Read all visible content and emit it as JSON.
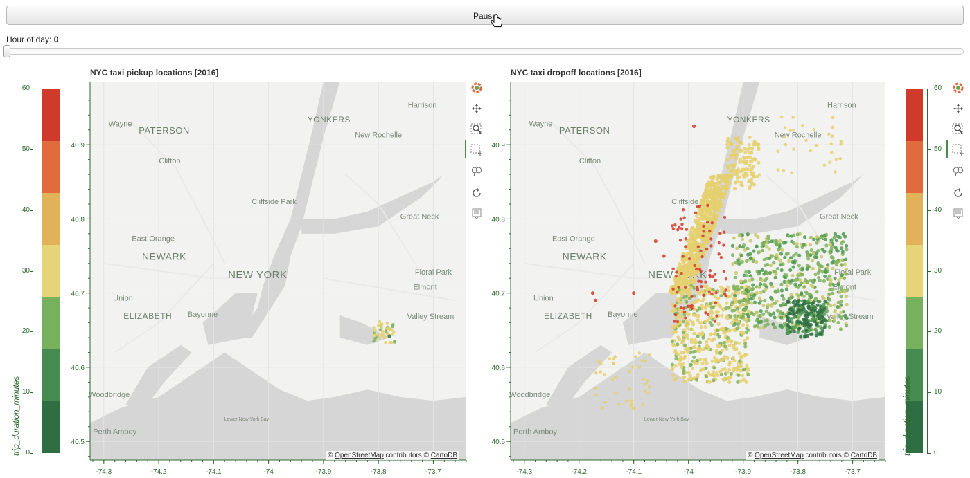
{
  "controls": {
    "pause_label": "Pause",
    "slider_label": "Hour of day:",
    "slider_value": "0",
    "slider_fraction": 0.0
  },
  "colorbar": {
    "title": "trip_duration_minutes",
    "ticks": [
      "0",
      "10",
      "20",
      "30",
      "40",
      "50",
      "60"
    ],
    "bands": [
      "#2f6e43",
      "#468c50",
      "#78b15d",
      "#e6d478",
      "#e2b25a",
      "#e06b3c",
      "#cf3a2b"
    ]
  },
  "plots": [
    {
      "title": "NYC taxi pickup locations [2016]",
      "x_ticks": [
        "-74.3",
        "-74.2",
        "-74.1",
        "-74",
        "-73.9",
        "-73.8",
        "-73.7"
      ],
      "y_ticks": [
        "40.9",
        "40.8",
        "40.7",
        "40.6",
        "40.5"
      ]
    },
    {
      "title": "NYC taxi dropoff locations [2016]",
      "x_ticks": [
        "-74.3",
        "-74.2",
        "-74.1",
        "-74",
        "-73.9",
        "-73.8",
        "-73.7"
      ],
      "y_ticks": [
        "40.9",
        "40.8",
        "40.7",
        "40.6",
        "40.5"
      ]
    }
  ],
  "attribution": {
    "copyright": "©",
    "osm": "OpenStreetMap",
    "contributors": "contributors,©",
    "carto": "CartoDB"
  },
  "map_labels": [
    "Harrison",
    "Wayne",
    "PATERSON",
    "YONKERS",
    "New Rochelle",
    "Clifton",
    "Cliffside Park",
    "Great Neck",
    "East Orange",
    "NEWARK",
    "NEW YORK",
    "Floral Park",
    "Elmont",
    "Union",
    "ELIZABETH",
    "Bayonne",
    "Valley Stream",
    "Woodbridge",
    "Perth Amboy",
    "Lower New York Bay"
  ],
  "toolbar": [
    "bokeh-logo-icon",
    "pan-icon",
    "box-zoom-icon",
    "box-select-icon",
    "lasso-icon",
    "reset-icon",
    "save-icon"
  ]
}
